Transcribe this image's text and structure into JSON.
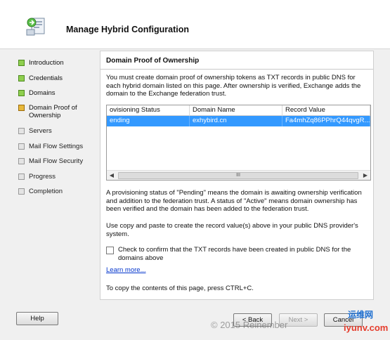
{
  "window": {
    "title": "Manage Hybrid Configuration"
  },
  "nav": {
    "items": [
      {
        "label": "Introduction",
        "state": "done"
      },
      {
        "label": "Credentials",
        "state": "done"
      },
      {
        "label": "Domains",
        "state": "done"
      },
      {
        "label": "Domain Proof of Ownership",
        "state": "current"
      },
      {
        "label": "Servers",
        "state": "pending"
      },
      {
        "label": "Mail Flow Settings",
        "state": "pending"
      },
      {
        "label": "Mail Flow Security",
        "state": "pending"
      },
      {
        "label": "Progress",
        "state": "pending"
      },
      {
        "label": "Completion",
        "state": "pending"
      }
    ]
  },
  "main": {
    "section_title": "Domain Proof of Ownership",
    "intro": "You must create domain proof of ownership tokens as TXT records in public DNS for each hybrid domain listed on this page. After ownership is verified, Exchange adds the domain to the Exchange federation trust.",
    "table": {
      "columns": [
        "ovisioning Status",
        "Domain Name",
        "Record Value"
      ],
      "rows": [
        [
          "ending",
          "exhybird.cn",
          "Fa4mhZq86PPhrQ44qvgR..."
        ]
      ],
      "scroll_thumb": "III"
    },
    "status_info": "A provisioning status of \"Pending\" means the domain is awaiting ownership verification and addition to the federation trust. A status of \"Active\" means domain ownership has been verified and the domain has been added to the federation trust.",
    "copy_info": "Use copy and paste to create the record value(s) above in your public DNS provider's system.",
    "confirm_label": "Check to confirm that the TXT records have been created in public DNS for the domains above",
    "learn_more": "Learn more...",
    "copy_hint": "To copy the contents of this page, press CTRL+C."
  },
  "buttons": {
    "help": "Help",
    "back": "< Back",
    "next": "Next >",
    "cancel": "Cancel"
  },
  "watermark": {
    "text": "© 2015 Reinember",
    "logo_top": "运维网",
    "logo_bottom": "iyunv.com"
  },
  "colors": {
    "selection": "#3399ff",
    "done": "#8fcf4f",
    "current": "#e8b93b",
    "link": "#0033cc"
  }
}
